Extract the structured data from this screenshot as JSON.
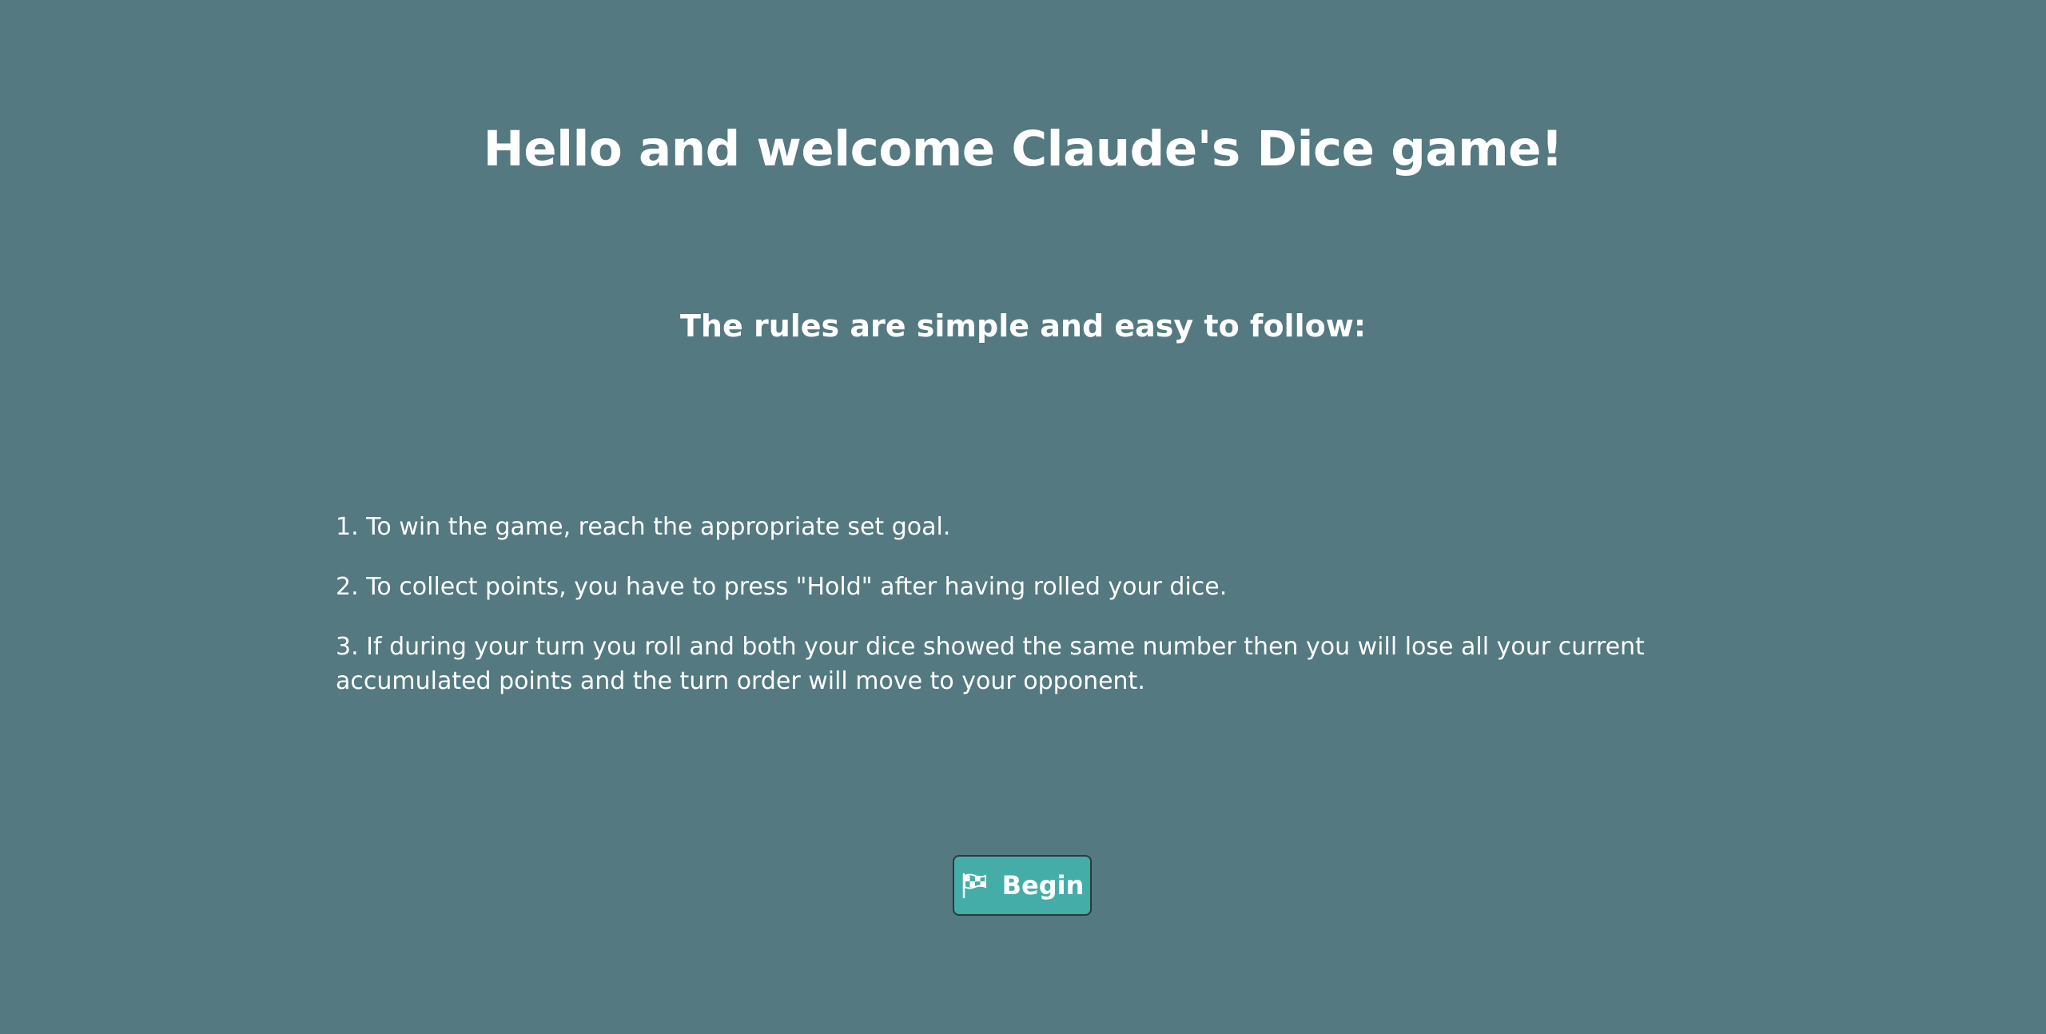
{
  "title": "Hello and welcome Claude's Dice game!",
  "subtitle": "The rules are simple and easy to follow:",
  "rules": [
    "1. To win the game, reach the appropriate set goal.",
    "2. To collect points, you have to press \"Hold\" after having rolled your dice.",
    "3. If during your turn you roll and both your dice showed the same number then you will lose all your current accumulated points and the turn order will move to your opponent."
  ],
  "begin_button": {
    "label": "Begin",
    "icon": "checkered-flag-icon"
  },
  "colors": {
    "background": "#547980",
    "button": "#45ada8",
    "text": "#ffffff"
  }
}
